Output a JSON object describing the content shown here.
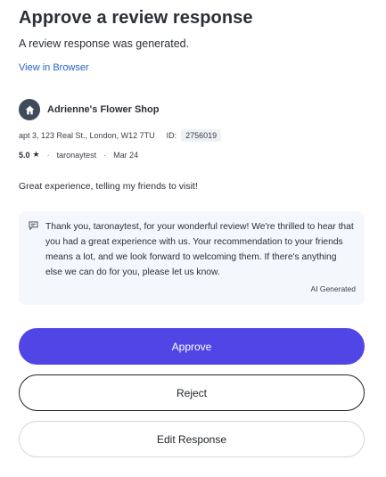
{
  "header": {
    "title": "Approve a review response",
    "subtitle": "A review response was generated.",
    "view_link": "View in Browser"
  },
  "business": {
    "icon": "home-icon",
    "name": "Adrienne's Flower Shop",
    "address": "apt 3, 123 Real St., London, W12 7TU",
    "id_label": "ID:",
    "id_value": "2756019"
  },
  "review": {
    "rating": "5.0",
    "star": "★",
    "author": "taronaytest",
    "date": "Mar 24",
    "text": "Great experience, telling my friends to visit!"
  },
  "response": {
    "icon": "comment-icon",
    "text": "Thank you, taronaytest, for your wonderful review! We're thrilled to hear that you had a great experience with us. Your recommendation to your friends means a lot, and we look forward to welcoming them. If there's anything else we can do for you, please let us know.",
    "source_label": "AI Generated"
  },
  "actions": {
    "approve": "Approve",
    "reject": "Reject",
    "edit": "Edit Response"
  },
  "colors": {
    "primary": "#4f46e5",
    "link": "#2563c9",
    "response_bg": "#f4f7fb"
  }
}
